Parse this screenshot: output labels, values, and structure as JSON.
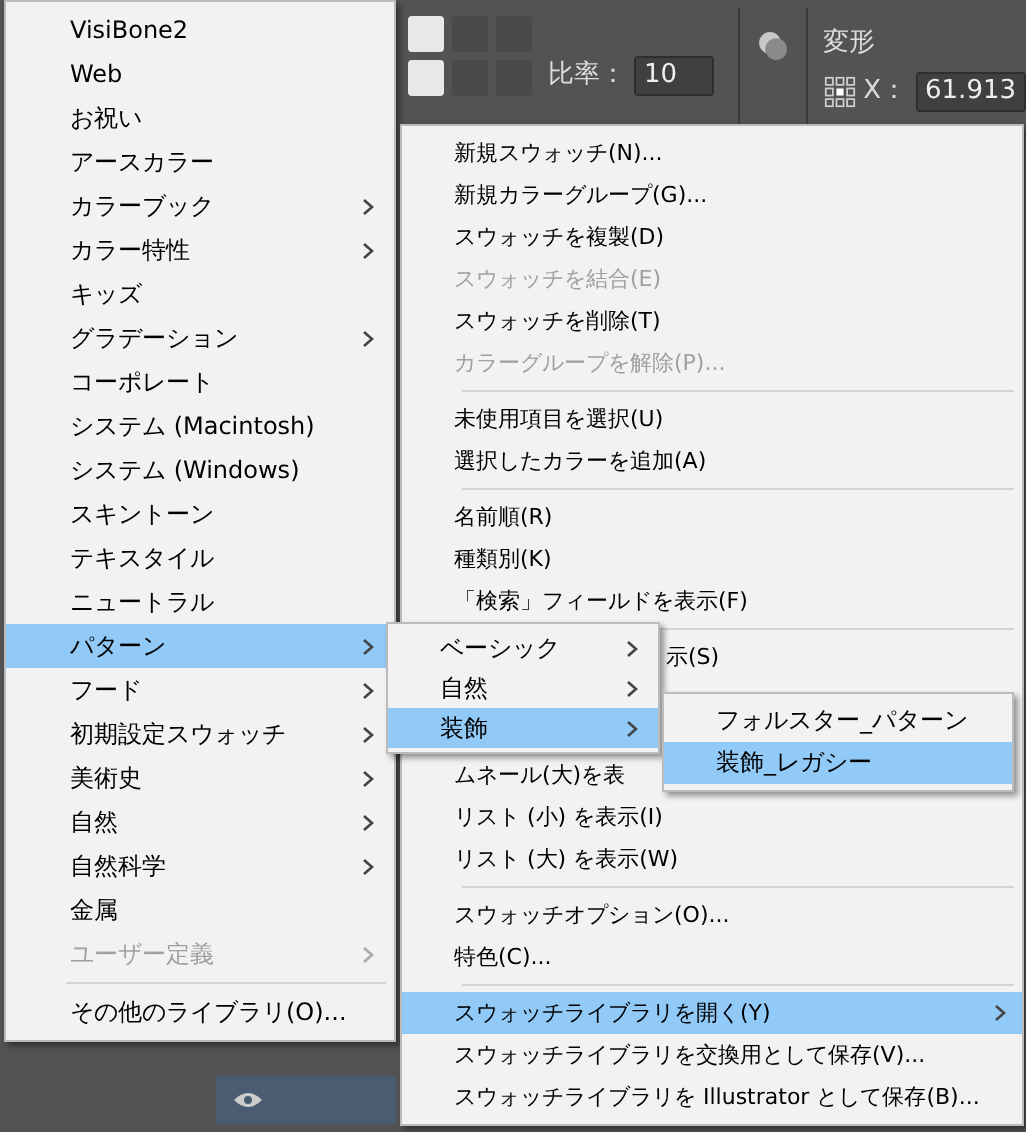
{
  "toolbar": {
    "ratio_label": "比率：",
    "ratio_value": "10"
  },
  "transform_panel": {
    "title": "変形",
    "x_label": "X：",
    "x_value": "61.913"
  },
  "library_menu": {
    "groups": [
      [
        {
          "label": "VisiBone2",
          "has_submenu": false,
          "selected": false,
          "disabled": false
        },
        {
          "label": "Web",
          "has_submenu": false,
          "selected": false,
          "disabled": false
        },
        {
          "label": "お祝い",
          "has_submenu": false,
          "selected": false,
          "disabled": false
        },
        {
          "label": "アースカラー",
          "has_submenu": false,
          "selected": false,
          "disabled": false
        },
        {
          "label": "カラーブック",
          "has_submenu": true,
          "selected": false,
          "disabled": false
        },
        {
          "label": "カラー特性",
          "has_submenu": true,
          "selected": false,
          "disabled": false
        },
        {
          "label": "キッズ",
          "has_submenu": false,
          "selected": false,
          "disabled": false
        },
        {
          "label": "グラデーション",
          "has_submenu": true,
          "selected": false,
          "disabled": false
        },
        {
          "label": "コーポレート",
          "has_submenu": false,
          "selected": false,
          "disabled": false
        },
        {
          "label": "システム (Macintosh)",
          "has_submenu": false,
          "selected": false,
          "disabled": false
        },
        {
          "label": "システム (Windows)",
          "has_submenu": false,
          "selected": false,
          "disabled": false
        },
        {
          "label": "スキントーン",
          "has_submenu": false,
          "selected": false,
          "disabled": false
        },
        {
          "label": "テキスタイル",
          "has_submenu": false,
          "selected": false,
          "disabled": false
        },
        {
          "label": "ニュートラル",
          "has_submenu": false,
          "selected": false,
          "disabled": false
        },
        {
          "label": "パターン",
          "has_submenu": true,
          "selected": true,
          "disabled": false
        },
        {
          "label": "フード",
          "has_submenu": true,
          "selected": false,
          "disabled": false
        },
        {
          "label": "初期設定スウォッチ",
          "has_submenu": true,
          "selected": false,
          "disabled": false
        },
        {
          "label": "美術史",
          "has_submenu": true,
          "selected": false,
          "disabled": false
        },
        {
          "label": "自然",
          "has_submenu": true,
          "selected": false,
          "disabled": false
        },
        {
          "label": "自然科学",
          "has_submenu": true,
          "selected": false,
          "disabled": false
        },
        {
          "label": "金属",
          "has_submenu": false,
          "selected": false,
          "disabled": false
        },
        {
          "label": "ユーザー定義",
          "has_submenu": true,
          "selected": false,
          "disabled": true
        }
      ],
      [
        {
          "label": "その他のライブラリ(O)...",
          "has_submenu": false,
          "selected": false,
          "disabled": false
        }
      ]
    ]
  },
  "swatch_menu": {
    "groups": [
      [
        {
          "kind": "normal",
          "label": "新規スウォッチ(N)...",
          "has_submenu": false,
          "selected": false,
          "disabled": false
        },
        {
          "kind": "normal",
          "label": "新規カラーグループ(G)...",
          "has_submenu": false,
          "selected": false,
          "disabled": false
        },
        {
          "kind": "normal",
          "label": "スウォッチを複製(D)",
          "has_submenu": false,
          "selected": false,
          "disabled": false
        },
        {
          "kind": "normal",
          "label": "スウォッチを結合(E)",
          "has_submenu": false,
          "selected": false,
          "disabled": true
        },
        {
          "kind": "normal",
          "label": "スウォッチを削除(T)",
          "has_submenu": false,
          "selected": false,
          "disabled": false
        },
        {
          "kind": "normal",
          "label": "カラーグループを解除(P)...",
          "has_submenu": false,
          "selected": false,
          "disabled": true
        }
      ],
      [
        {
          "kind": "normal",
          "label": "未使用項目を選択(U)",
          "has_submenu": false,
          "selected": false,
          "disabled": false
        },
        {
          "kind": "normal",
          "label": "選択したカラーを追加(A)",
          "has_submenu": false,
          "selected": false,
          "disabled": false
        }
      ],
      [
        {
          "kind": "normal",
          "label": "名前順(R)",
          "has_submenu": false,
          "selected": false,
          "disabled": false
        },
        {
          "kind": "normal",
          "label": "種類別(K)",
          "has_submenu": false,
          "selected": false,
          "disabled": false
        },
        {
          "kind": "normal",
          "label": "「検索」フィールドを表示(F)",
          "has_submenu": false,
          "selected": false,
          "disabled": false
        }
      ],
      [
        {
          "kind": "covered_left",
          "label": "示(S)",
          "has_submenu": false,
          "selected": false,
          "disabled": false
        },
        {
          "kind": "covered_top",
          "label": "ムネール(大)を表",
          "has_submenu": false,
          "selected": false,
          "disabled": false
        },
        {
          "kind": "normal",
          "label": "リスト (小) を表示(I)",
          "has_submenu": false,
          "selected": false,
          "disabled": false
        },
        {
          "kind": "normal",
          "label": "リスト (大) を表示(W)",
          "has_submenu": false,
          "selected": false,
          "disabled": false
        }
      ],
      [
        {
          "kind": "normal",
          "label": "スウォッチオプション(O)...",
          "has_submenu": false,
          "selected": false,
          "disabled": false
        },
        {
          "kind": "normal",
          "label": "特色(C)...",
          "has_submenu": false,
          "selected": false,
          "disabled": false
        }
      ],
      [
        {
          "kind": "normal",
          "label": "スウォッチライブラリを開く(Y)",
          "has_submenu": true,
          "selected": true,
          "disabled": false
        },
        {
          "kind": "normal",
          "label": "スウォッチライブラリを交換用として保存(V)...",
          "has_submenu": false,
          "selected": false,
          "disabled": false
        },
        {
          "kind": "normal",
          "label": "スウォッチライブラリを Illustrator として保存(B)...",
          "has_submenu": false,
          "selected": false,
          "disabled": false
        }
      ]
    ]
  },
  "pattern_menu": {
    "items": [
      {
        "label": "ベーシック",
        "has_submenu": true,
        "selected": false
      },
      {
        "label": "自然",
        "has_submenu": true,
        "selected": false
      },
      {
        "label": "装飾",
        "has_submenu": true,
        "selected": true
      }
    ]
  },
  "decor_menu": {
    "items": [
      {
        "label": "フォルスター_パターン",
        "selected": false
      },
      {
        "label": "装飾_レガシー",
        "selected": true
      }
    ]
  }
}
